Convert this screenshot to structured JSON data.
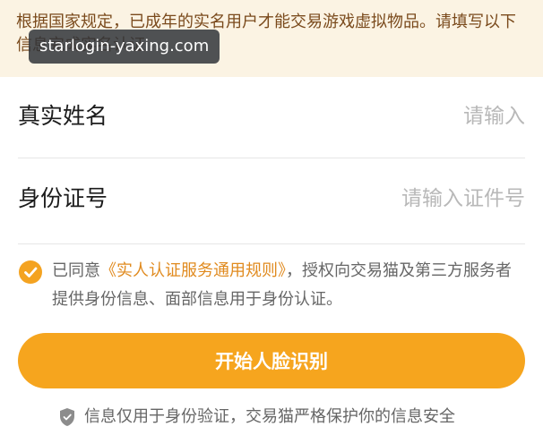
{
  "notice": {
    "text": "根据国家规定，已成年的实名用户才能交易游戏虚拟物品。请填写以下信息完成实名认证"
  },
  "watermark": {
    "text": "starlogin-yaxing.com"
  },
  "form": {
    "name_label": "真实姓名",
    "name_placeholder": "请输入",
    "name_value": "",
    "id_label": "身份证号",
    "id_placeholder": "请输入证件号",
    "id_value": ""
  },
  "agreement": {
    "checked": true,
    "prefix": "已同意",
    "link_text": "《实人认证服务通用规则》",
    "suffix": "，授权向交易猫及第三方服务者提供身份信息、面部信息用于身份认证。"
  },
  "start_button": {
    "label": "开始人脸识别"
  },
  "privacy": {
    "text": "信息仅用于身份验证，交易猫严格保护你的信息安全"
  },
  "colors": {
    "accent": "#f6a51e",
    "link": "#e08a1e",
    "notice_background": "#fbf3e3",
    "notice_text": "#7a4a1c"
  },
  "icons": {
    "agree": "check-circle-icon",
    "privacy": "shield-icon"
  }
}
